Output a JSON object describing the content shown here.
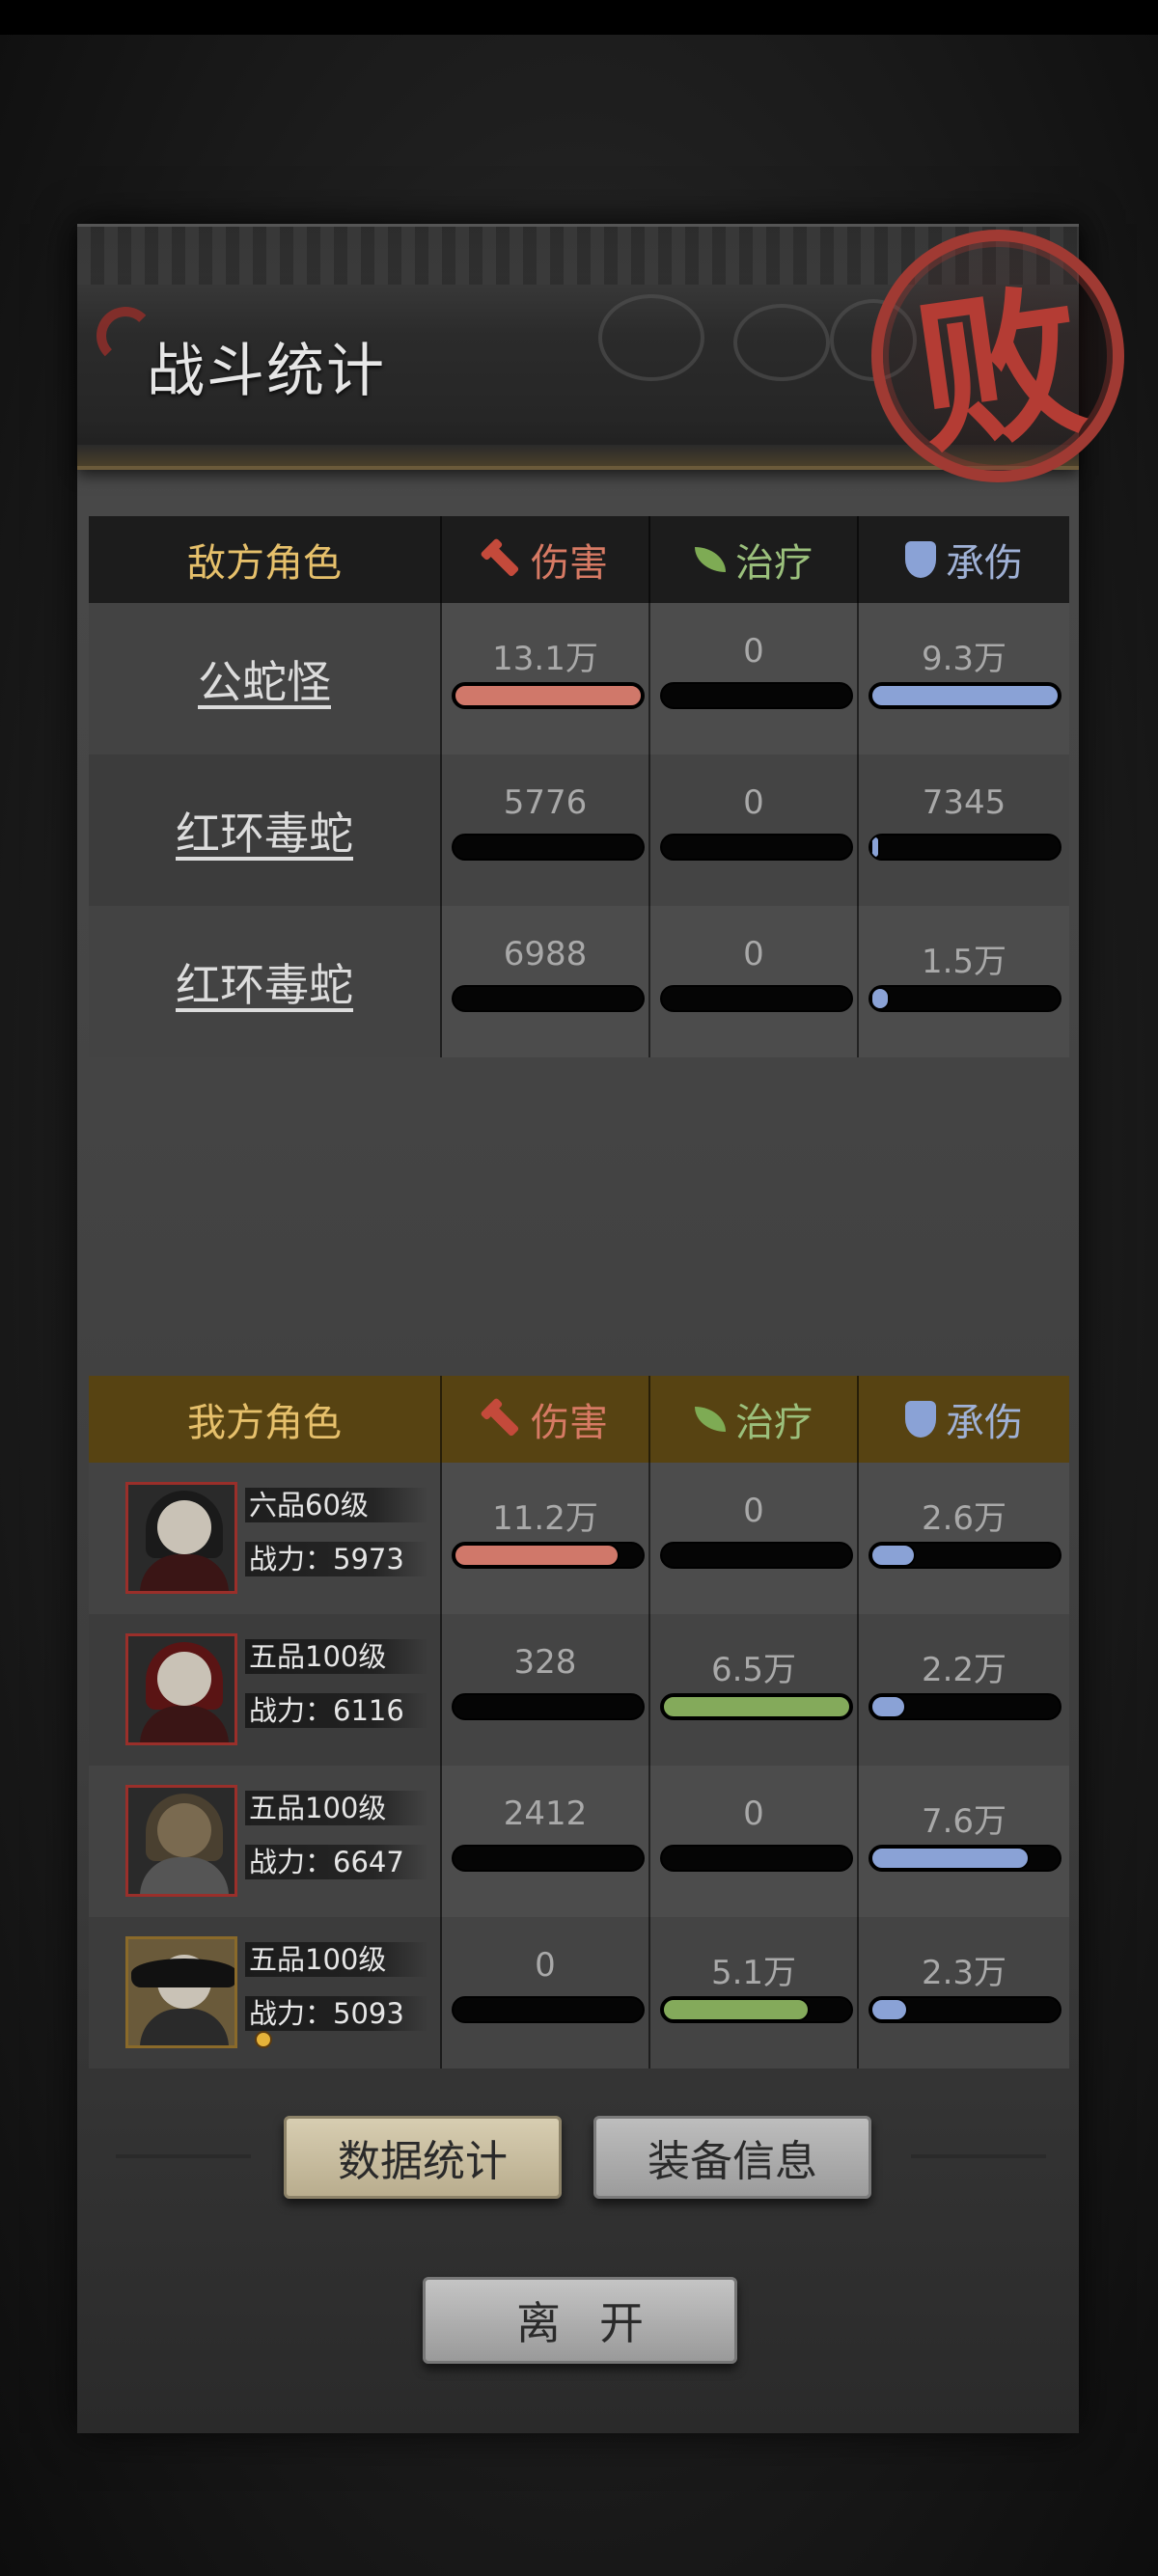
{
  "header": {
    "title": "战斗统计",
    "seal": "败"
  },
  "enemy": {
    "columns": {
      "name": "敌方角色",
      "damage": "伤害",
      "heal": "治疗",
      "taken": "承伤"
    },
    "rows": [
      {
        "name": "公蛇怪",
        "damage": "13.1万",
        "heal": "0",
        "taken": "9.3万",
        "damage_ratio": 1.0,
        "heal_ratio": 0,
        "taken_ratio": 1.0
      },
      {
        "name": "红环毒蛇",
        "damage": "5776",
        "heal": "0",
        "taken": "7345",
        "damage_ratio": 0.0,
        "heal_ratio": 0,
        "taken_ratio": 0.04
      },
      {
        "name": "红环毒蛇",
        "damage": "6988",
        "heal": "0",
        "taken": "1.5万",
        "damage_ratio": 0.0,
        "heal_ratio": 0,
        "taken_ratio": 0.1
      }
    ]
  },
  "ally": {
    "columns": {
      "name": "我方角色",
      "damage": "伤害",
      "heal": "治疗",
      "taken": "承伤"
    },
    "rows": [
      {
        "rank": "六品60级",
        "power": "战力：5973",
        "damage": "11.2万",
        "heal": "0",
        "taken": "2.6万",
        "damage_ratio": 0.88,
        "heal_ratio": 0,
        "taken_ratio": 0.24
      },
      {
        "rank": "五品100级",
        "power": "战力：6116",
        "damage": "328",
        "heal": "6.5万",
        "taken": "2.2万",
        "damage_ratio": 0,
        "heal_ratio": 1.0,
        "taken_ratio": 0.19
      },
      {
        "rank": "五品100级",
        "power": "战力：6647",
        "damage": "2412",
        "heal": "0",
        "taken": "7.6万",
        "damage_ratio": 0,
        "heal_ratio": 0,
        "taken_ratio": 0.84
      },
      {
        "rank": "五品100级",
        "power": "战力：5093",
        "damage": "0",
        "heal": "5.1万",
        "taken": "2.3万",
        "damage_ratio": 0,
        "heal_ratio": 0.78,
        "taken_ratio": 0.2
      }
    ]
  },
  "buttons": {
    "stats": "数据统计",
    "equipment": "装备信息",
    "leave": "离开"
  }
}
